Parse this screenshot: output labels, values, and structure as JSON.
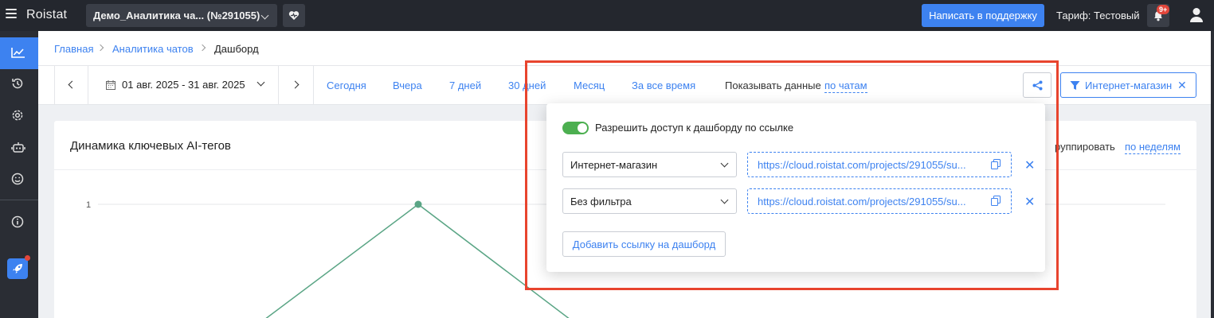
{
  "topbar": {
    "logo": "Roistat",
    "project": "Демо_Аналитика ча... (№291055)",
    "support_label": "Написать в поддержку",
    "tariff": "Тариф: Тестовый",
    "notifications_badge": "9+"
  },
  "sidebar": {
    "items": [
      "analytics-icon",
      "history-icon",
      "settings-icon",
      "robot-icon",
      "smile-icon",
      "info-icon",
      "rocket-icon"
    ],
    "accent": "#3d82f0"
  },
  "breadcrumbs": [
    "Главная",
    "Аналитика чатов",
    "Дашборд"
  ],
  "toolbar": {
    "date_range": "01 авг. 2025 - 31 авг. 2025",
    "periods": [
      "Сегодня",
      "Вчера",
      "7 дней",
      "30 дней",
      "Месяц",
      "За все время"
    ],
    "show_data_label": "Показывать данные",
    "show_data_value": "по чатам",
    "filter_label": "Интернет-магазин"
  },
  "card": {
    "title": "Динамика ключевых AI-тегов",
    "group_label": "руппировать",
    "group_value": "по неделям"
  },
  "chart_data": {
    "type": "line",
    "y_tick": "1",
    "series_color": "#5aa585"
  },
  "share_popup": {
    "toggle_label": "Разрешить доступ к дашборду по ссылке",
    "toggle_on": true,
    "links": [
      {
        "filter": "Интернет-магазин",
        "url": "https://cloud.roistat.com/projects/291055/su..."
      },
      {
        "filter": "Без фильтра",
        "url": "https://cloud.roistat.com/projects/291055/su..."
      }
    ],
    "remove_symbol": "✕",
    "add_label": "Добавить ссылку на дашборд"
  },
  "colors": {
    "highlight": "#e8442e",
    "link": "#3d82f0",
    "toggle_on": "#4caf50"
  }
}
